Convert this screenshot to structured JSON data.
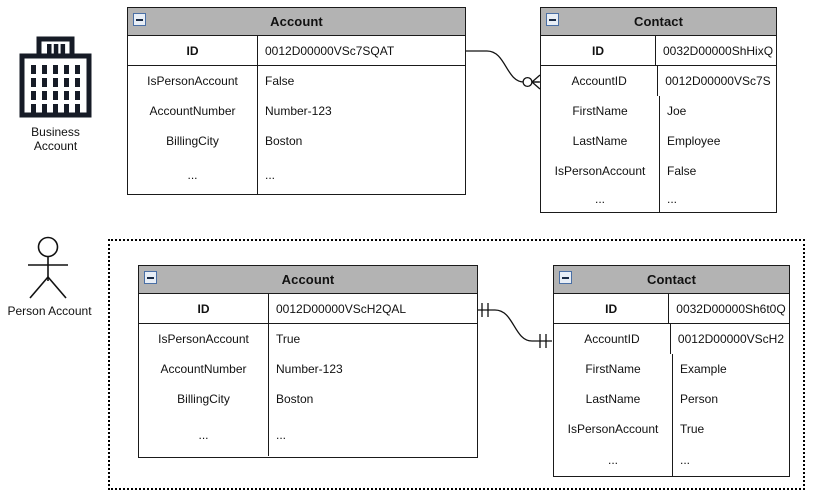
{
  "diagram": {
    "title": "Salesforce Account and Contact data model comparison",
    "colors": {
      "header_fill": "#b3b3b3",
      "border": "#1a1a1a",
      "collapse_border": "#4a6fa5",
      "text": "#111111",
      "group_border": "#000000"
    }
  },
  "actors": [
    {
      "id": "business-account",
      "icon": "office-building-icon",
      "label": "Business\nAccount"
    },
    {
      "id": "person-account",
      "icon": "stick-figure-actor-icon",
      "label": "Person Account"
    }
  ],
  "business_section": {
    "account_table": {
      "title": "Account",
      "collapse_icon": "collapse-minus-icon",
      "rows": [
        {
          "name": "ID",
          "value": "0012D00000VSc7SQAT",
          "primary": true
        },
        {
          "name": "IsPersonAccount",
          "value": "False",
          "primary": false
        },
        {
          "name": "AccountNumber",
          "value": "Number-123",
          "primary": false
        },
        {
          "name": "BillingCity",
          "value": "Boston",
          "primary": false
        },
        {
          "name": "...",
          "value": "...",
          "primary": false
        }
      ]
    },
    "contact_table": {
      "title": "Contact",
      "collapse_icon": "collapse-minus-icon",
      "rows": [
        {
          "name": "ID",
          "value": "0032D00000ShHixQ",
          "primary": true
        },
        {
          "name": "AccountID",
          "value": "0012D00000VSc7S",
          "primary": false
        },
        {
          "name": "FirstName",
          "value": "Joe",
          "primary": false
        },
        {
          "name": "LastName",
          "value": "Employee",
          "primary": false
        },
        {
          "name": "IsPersonAccount",
          "value": "False",
          "primary": false
        },
        {
          "name": "...",
          "value": "...",
          "primary": false
        }
      ]
    },
    "relationship": {
      "notation": "zero-or-many",
      "from": "Account.ID",
      "to": "Contact.AccountID"
    }
  },
  "person_section": {
    "account_table": {
      "title": "Account",
      "collapse_icon": "collapse-minus-icon",
      "rows": [
        {
          "name": "ID",
          "value": "0012D00000VScH2QAL",
          "primary": true
        },
        {
          "name": "IsPersonAccount",
          "value": "True",
          "primary": false
        },
        {
          "name": "AccountNumber",
          "value": "Number-123",
          "primary": false
        },
        {
          "name": "BillingCity",
          "value": "Boston",
          "primary": false
        },
        {
          "name": "...",
          "value": "...",
          "primary": false
        }
      ]
    },
    "contact_table": {
      "title": "Contact",
      "collapse_icon": "collapse-minus-icon",
      "rows": [
        {
          "name": "ID",
          "value": "0032D00000Sh6t0Q",
          "primary": true
        },
        {
          "name": "AccountID",
          "value": "0012D00000VScH2",
          "primary": false
        },
        {
          "name": "FirstName",
          "value": "Example",
          "primary": false
        },
        {
          "name": "LastName",
          "value": "Person",
          "primary": false
        },
        {
          "name": "IsPersonAccount",
          "value": "True",
          "primary": false
        },
        {
          "name": "...",
          "value": "...",
          "primary": false
        }
      ]
    },
    "relationship": {
      "notation": "one-and-only-one",
      "from": "Account.ID",
      "to": "Contact.AccountID"
    }
  }
}
